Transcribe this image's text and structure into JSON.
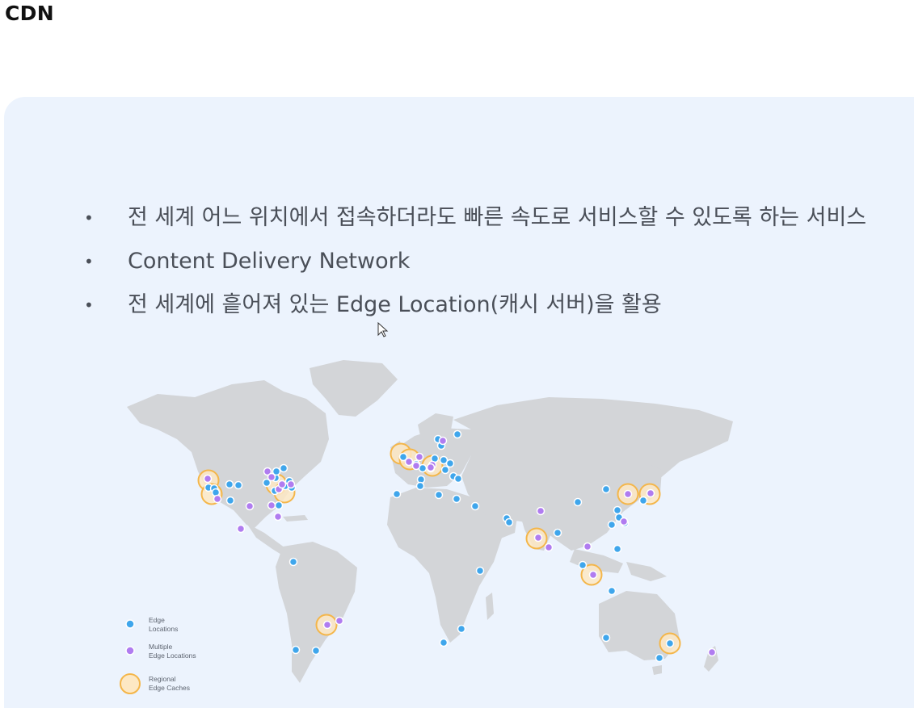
{
  "page": {
    "title": "CDN"
  },
  "slide": {
    "bullets": [
      "전 세계 어느 위치에서 접속하더라도 빠른 속도로 서비스할 수 있도록 하는 서비스",
      "Content Delivery Network",
      "전 세계에 흩어져 있는 Edge Location(캐시 서버)을 활용"
    ]
  },
  "legend": {
    "edge_locations": [
      "Edge",
      "Locations"
    ],
    "multiple_edge_locations": [
      "Multiple",
      "Edge Locations"
    ],
    "regional_edge_caches": [
      "Regional",
      "Edge Caches"
    ]
  },
  "colors": {
    "edge_location": "#3fa6ec",
    "multiple_edge_location": "#b07cf0",
    "regional_cache_fill": "#fde8c4",
    "regional_cache_ring": "#f4b64a",
    "land": "#d3d5d8",
    "slide_background": "#ecf3fd"
  },
  "icons": {
    "cursor": "mouse-pointer-icon"
  }
}
